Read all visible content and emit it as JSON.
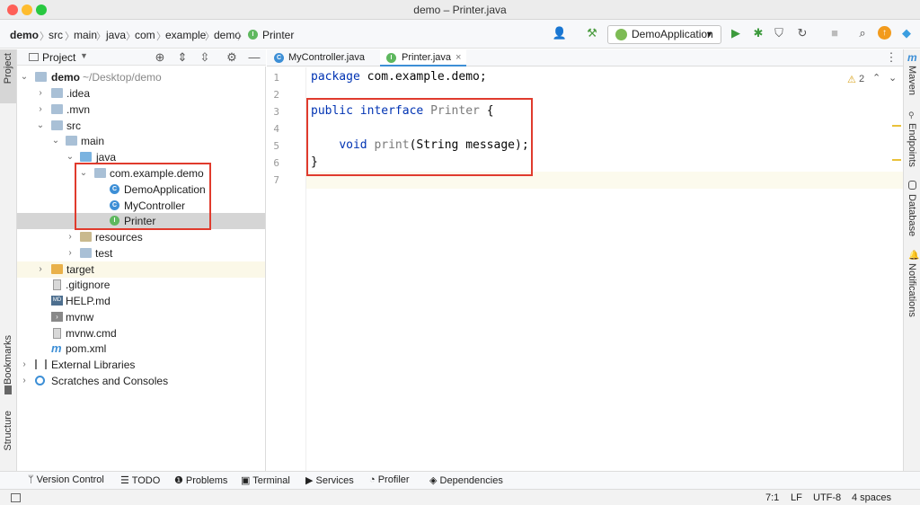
{
  "window": {
    "title": "demo – Printer.java"
  },
  "breadcrumb": [
    "demo",
    "src",
    "main",
    "java",
    "com",
    "example",
    "demo",
    "Printer"
  ],
  "run_config": {
    "label": "DemoApplication"
  },
  "project_panel": {
    "title": "Project"
  },
  "tree": [
    {
      "label": "demo",
      "path": "~/Desktop/demo"
    },
    {
      "label": ".idea"
    },
    {
      "label": ".mvn"
    },
    {
      "label": "src"
    },
    {
      "label": "main"
    },
    {
      "label": "java"
    },
    {
      "label": "com.example.demo"
    },
    {
      "label": "DemoApplication"
    },
    {
      "label": "MyController"
    },
    {
      "label": "Printer"
    },
    {
      "label": "resources"
    },
    {
      "label": "test"
    },
    {
      "label": "target"
    },
    {
      "label": ".gitignore"
    },
    {
      "label": "HELP.md"
    },
    {
      "label": "mvnw"
    },
    {
      "label": "mvnw.cmd"
    },
    {
      "label": "pom.xml"
    },
    {
      "label": "External Libraries"
    },
    {
      "label": "Scratches and Consoles"
    }
  ],
  "tabs": [
    {
      "label": "MyController.java"
    },
    {
      "label": "Printer.java"
    }
  ],
  "editor": {
    "lines": [
      "1",
      "2",
      "3",
      "4",
      "5",
      "6",
      "7"
    ],
    "code": {
      "l1_kw": "package",
      "l1_rest": " com.example.demo;",
      "l3_kw1": "public",
      "l3_kw2": "interface",
      "l3_name": "Printer",
      "l3_brace": " {",
      "l5_kw": "void",
      "l5_name": "print",
      "l5_rest": "(String message);",
      "l6": "}"
    },
    "warnings": "2"
  },
  "left_strip": {
    "project": "Project",
    "bookmarks": "Bookmarks",
    "structure": "Structure"
  },
  "right_strip": {
    "maven": "Maven",
    "endpoints": "Endpoints",
    "database": "Database",
    "notifications": "Notifications"
  },
  "bottom_tabs": [
    "Version Control",
    "TODO",
    "Problems",
    "Terminal",
    "Services",
    "Profiler",
    "Dependencies"
  ],
  "status": {
    "position": "7:1",
    "line_ending": "LF",
    "encoding": "UTF-8",
    "indent": "4 spaces"
  },
  "colors": {
    "highlight_box": "#e03b2d",
    "keyword": "#0033b3",
    "class_icon": "#3d8fd6",
    "interface_icon": "#5fb85f"
  }
}
